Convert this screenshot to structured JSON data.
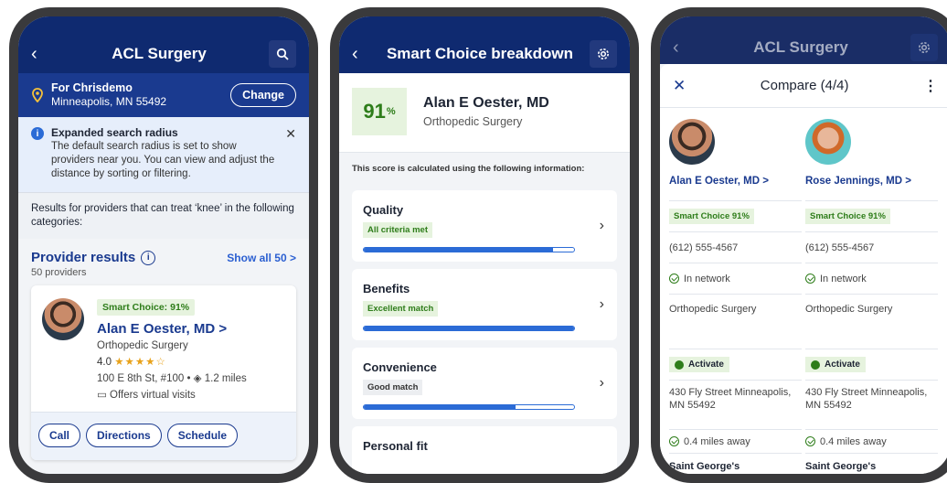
{
  "screen1": {
    "title": "ACL Surgery",
    "location_for": "For Chrisdemo",
    "location_city": "Minneapolis, MN 55492",
    "change_label": "Change",
    "alert_title": "Expanded search radius",
    "alert_body": "The default search radius is set to show providers near you. You can view and adjust the distance by sorting or filtering.",
    "results_desc": "Results for providers that can treat ‘knee’ in the following categories:",
    "provider_results": "Provider results",
    "show_all": "Show all 50 >",
    "provider_count": "50 providers",
    "card": {
      "badge": "Smart Choice: 91%",
      "name": "Alan E Oester, MD >",
      "specialty": "Orthopedic Surgery",
      "rating": "4.0",
      "stars": "★★★★☆",
      "rating_value": 4,
      "address": "100 E 8th St, #100 • ◈ 1.2 miles",
      "virtual": "▭ Offers virtual visits",
      "actions": [
        "Call",
        "Directions",
        "Schedule"
      ]
    }
  },
  "screen2": {
    "title": "Smart Choice breakdown",
    "score": "91",
    "score_unit": "%",
    "name": "Alan E Oester, MD",
    "specialty": "Orthopedic Surgery",
    "calc_text": "This score is calculated using the following information:",
    "metrics": [
      {
        "label": "Quality",
        "badge": "All criteria met",
        "fill": 0.9
      },
      {
        "label": "Benefits",
        "badge": "Excellent match",
        "fill": 1.0
      },
      {
        "label": "Convenience",
        "badge": "Good match",
        "fill": 0.72
      },
      {
        "label": "Personal fit",
        "badge": "",
        "fill": 0
      }
    ]
  },
  "screen3": {
    "bg_title": "ACL Surgery",
    "sheet_title": "Compare (4/4)",
    "providers": [
      {
        "name": "Alan E Oester, MD >",
        "badge": "Smart Choice 91%",
        "phone": "(612) 555-4567",
        "network": "In network",
        "specialty": "Orthopedic Surgery",
        "activate": "Activate",
        "address": "430 Fly Street Minneapolis, MN 55492",
        "distance": "0.4 miles away",
        "footer": "Saint George's"
      },
      {
        "name": "Rose Jennings, MD >",
        "badge": "Smart Choice 91%",
        "phone": "(612) 555-4567",
        "network": "In network",
        "specialty": "Orthopedic Surgery",
        "activate": "Activate",
        "address": "430 Fly Street Minneapolis, MN 55492",
        "distance": "0.4 miles away",
        "footer": "Saint George's"
      }
    ]
  },
  "colors": {
    "navy": "#0f2a70",
    "link_blue": "#1a3a8f",
    "green": "#2e7d1a",
    "green_bg": "#e6f3de",
    "bar_blue": "#2b6bd6"
  }
}
